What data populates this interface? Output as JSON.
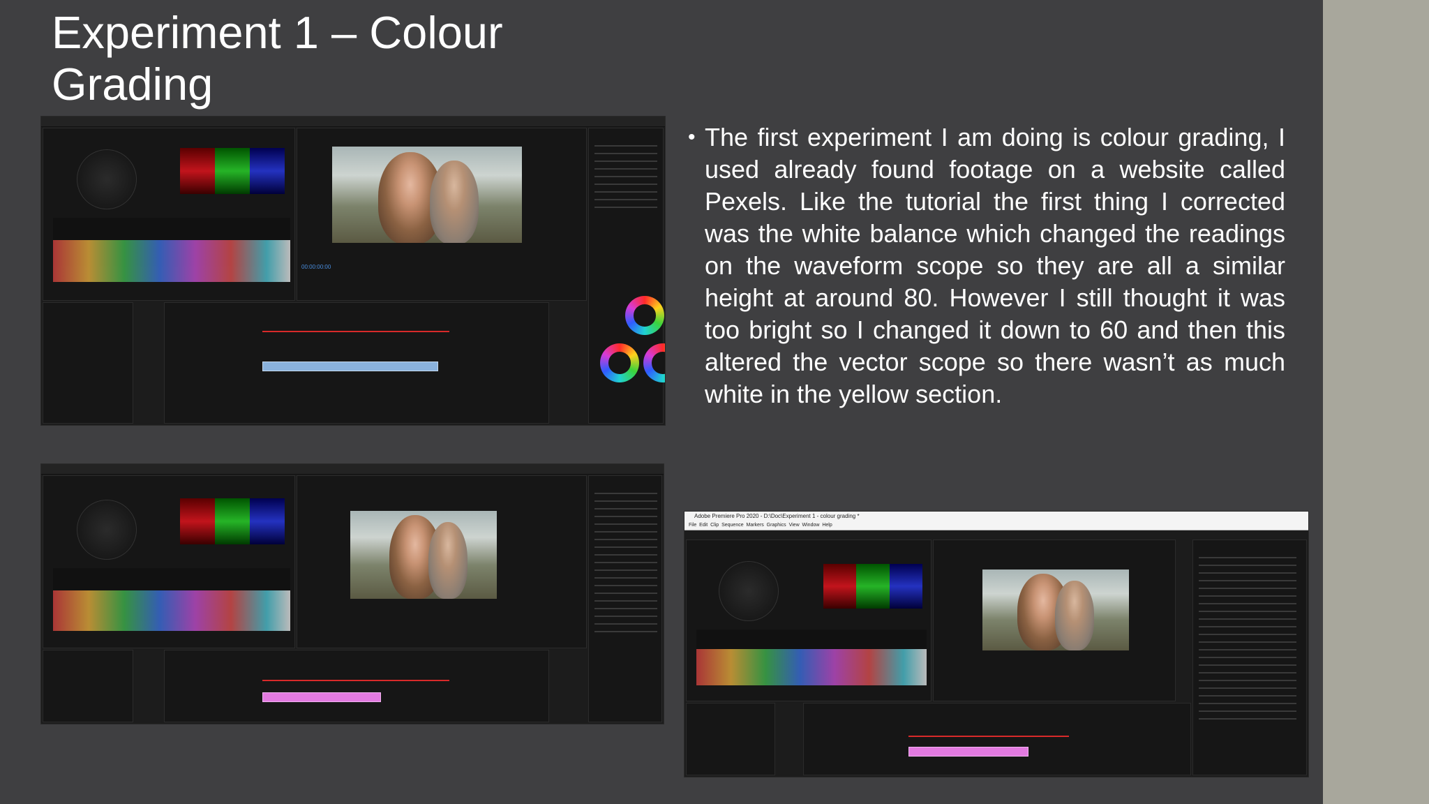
{
  "slide": {
    "title": "Experiment 1 – Colour Grading",
    "bullet": "The first experiment I am doing is colour grading, I used already found footage on a website called Pexels. Like the tutorial the first thing I corrected was the white balance which changed the readings on the waveform scope so they are all a similar height at around 80. However I still thought it was too bright so I changed it down to 60 and then this altered the vector scope so there wasn’t as much white in the yellow section.",
    "bullet_marker": "•"
  },
  "screenshots": {
    "shot3": {
      "window_title": "Adobe Premiere Pro 2020 - D:\\Doc\\Experiment 1 - colour grading *",
      "menu": [
        "File",
        "Edit",
        "Clip",
        "Sequence",
        "Markers",
        "Graphics",
        "View",
        "Window",
        "Help"
      ]
    }
  },
  "colors": {
    "background": "#3f3f41",
    "side_strip": "#a8a79c",
    "text": "#ffffff"
  }
}
